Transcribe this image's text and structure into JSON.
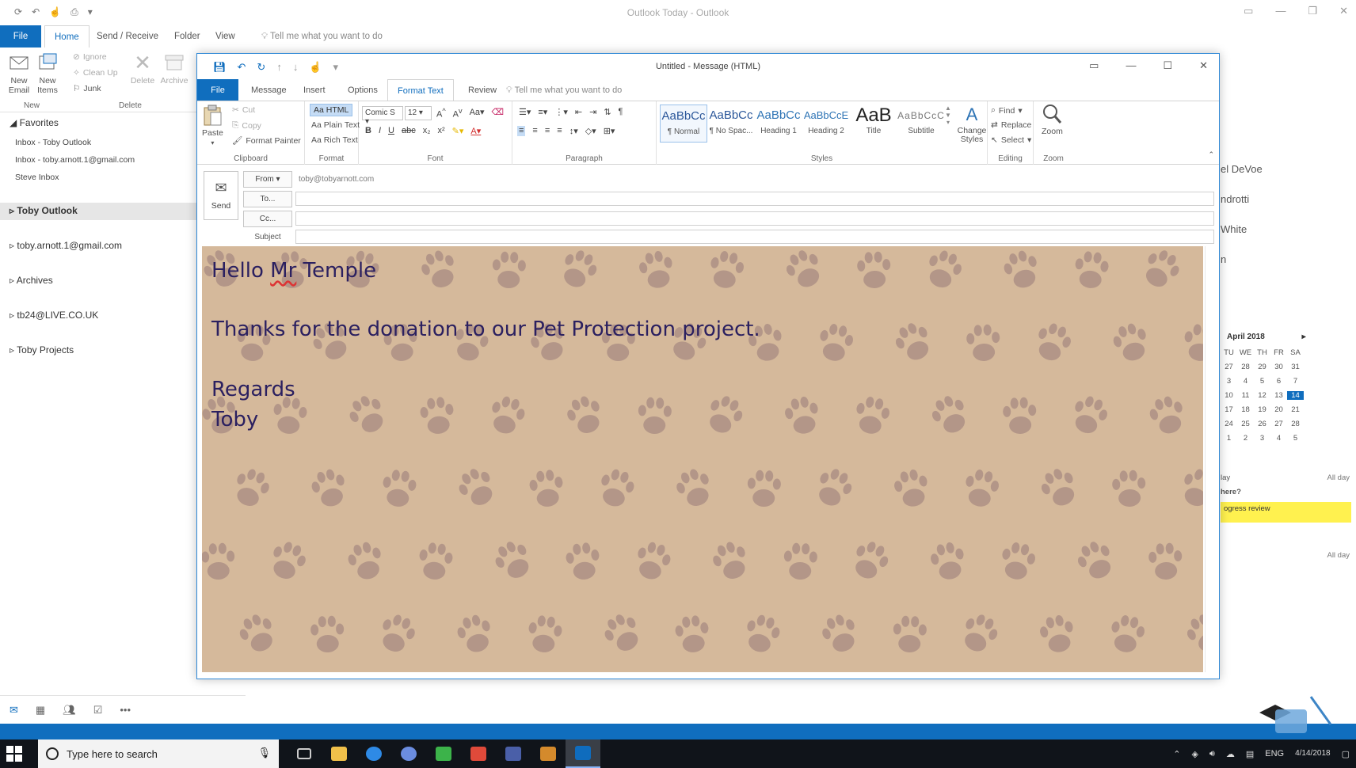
{
  "main": {
    "window_title": "Outlook Today - Outlook",
    "tabs": [
      "File",
      "Home",
      "Send / Receive",
      "Folder",
      "View"
    ],
    "tell_me": "Tell me what you want to do",
    "ribbon": {
      "new_email": "New Email",
      "new_items": "New Items",
      "ignore": "Ignore",
      "clean_up": "Clean Up",
      "junk": "Junk",
      "delete": "Delete",
      "archive": "Archive",
      "group_new": "New",
      "group_delete": "Delete"
    }
  },
  "folders": {
    "favorites": "Favorites",
    "fav_items": [
      "Inbox - Toby Outlook",
      "Inbox - toby.arnott.1@gmail.com",
      "Steve Inbox"
    ],
    "accounts": [
      "Toby Outlook",
      "toby.arnott.1@gmail.com",
      "Archives",
      "tb24@LIVE.CO.UK",
      "Toby Projects"
    ]
  },
  "todo": {
    "people": [
      "el DeVoe",
      "ndrotti",
      "White",
      "n"
    ],
    "calendar_month": "April 2018",
    "weekdays": [
      "TU",
      "WE",
      "TH",
      "FR",
      "SA"
    ],
    "weeks": [
      [
        "27",
        "28",
        "29",
        "30",
        "31"
      ],
      [
        "3",
        "4",
        "5",
        "6",
        "7"
      ],
      [
        "10",
        "11",
        "12",
        "13",
        "14"
      ],
      [
        "17",
        "18",
        "19",
        "20",
        "21"
      ],
      [
        "24",
        "25",
        "26",
        "27",
        "28"
      ],
      [
        "1",
        "2",
        "3",
        "4",
        "5"
      ]
    ],
    "today": "14",
    "all_day_1": "All day",
    "day_label": "lay",
    "where_label": "here?",
    "appointment": "ogress review",
    "all_day_2": "All day"
  },
  "compose": {
    "window_title": "Untitled - Message (HTML)",
    "tabs": [
      "File",
      "Message",
      "Insert",
      "Options",
      "Format Text",
      "Review"
    ],
    "tell_me": "Tell me what you want to do",
    "clipboard": {
      "paste": "Paste",
      "cut": "Cut",
      "copy": "Copy",
      "format_painter": "Format Painter",
      "label": "Clipboard"
    },
    "format": {
      "html": "Aa HTML",
      "plain": "Aa Plain Text",
      "rich": "Aa Rich Text",
      "label": "Format"
    },
    "font": {
      "name": "Comic S",
      "size": "12",
      "label": "Font"
    },
    "paragraph_label": "Paragraph",
    "styles": [
      {
        "preview": "AaBbCc",
        "name": "¶ Normal"
      },
      {
        "preview": "AaBbCc",
        "name": "¶ No Spac..."
      },
      {
        "preview": "AaBbCc",
        "name": "Heading 1"
      },
      {
        "preview": "AaBbCcE",
        "name": "Heading 2"
      },
      {
        "preview": "AaB",
        "name": "Title"
      },
      {
        "preview": "AaBbCcC",
        "name": "Subtitle"
      }
    ],
    "styles_label": "Styles",
    "change_styles": "Change Styles",
    "editing": {
      "find": "Find",
      "replace": "Replace",
      "select": "Select",
      "label": "Editing"
    },
    "zoom": {
      "button": "Zoom",
      "label": "Zoom"
    },
    "send": "Send",
    "from_button": "From",
    "from_value": "toby@tobyarnott.com",
    "to_button": "To...",
    "cc_button": "Cc...",
    "subject_label": "Subject",
    "body": {
      "line1a": "Hello ",
      "line1b": "Mr",
      "line1c": " Temple",
      "line2": "Thanks for the donation to our Pet Protection project.",
      "line3": "Regards",
      "line4": "Toby"
    },
    "colors": {
      "accent": "#106ebe",
      "body_bg": "#d5b99b",
      "paw": "#a88b82",
      "text": "#2b2060"
    }
  },
  "taskbar": {
    "search_placeholder": "Type here to search",
    "lang": "ENG",
    "time": "4/14/2018"
  }
}
